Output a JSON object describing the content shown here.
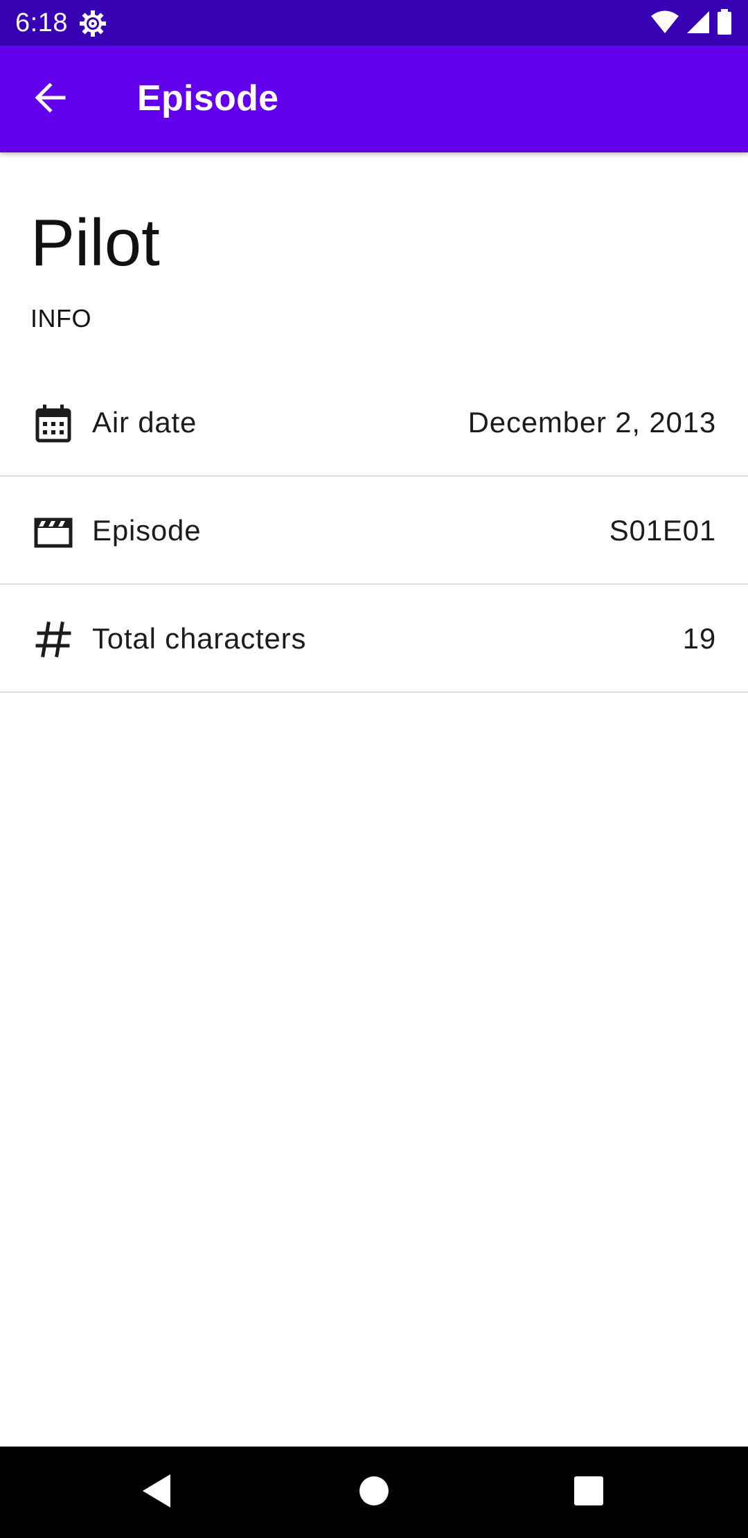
{
  "status_bar": {
    "time": "6:18",
    "settings_icon": "gear-icon",
    "wifi_icon": "wifi-icon",
    "signal_icon": "cell-signal-icon",
    "battery_icon": "battery-icon"
  },
  "app_bar": {
    "title": "Episode",
    "back_icon": "arrow-back-icon"
  },
  "episode": {
    "name": "Pilot",
    "section_label": "INFO"
  },
  "info_rows": [
    {
      "icon": "calendar-icon",
      "label": "Air date",
      "value": "December 2, 2013"
    },
    {
      "icon": "clapperboard-icon",
      "label": "Episode",
      "value": "S01E01"
    },
    {
      "icon": "hash-icon",
      "label": "Total characters",
      "value": "19"
    }
  ],
  "nav_bar": {
    "back_icon": "nav-back-triangle-icon",
    "home_icon": "nav-home-circle-icon",
    "recents_icon": "nav-recents-square-icon"
  },
  "colors": {
    "status_bar": "#3700b3",
    "app_bar": "#6200ee",
    "divider": "#dcdcdc",
    "nav_bar": "#000000"
  }
}
